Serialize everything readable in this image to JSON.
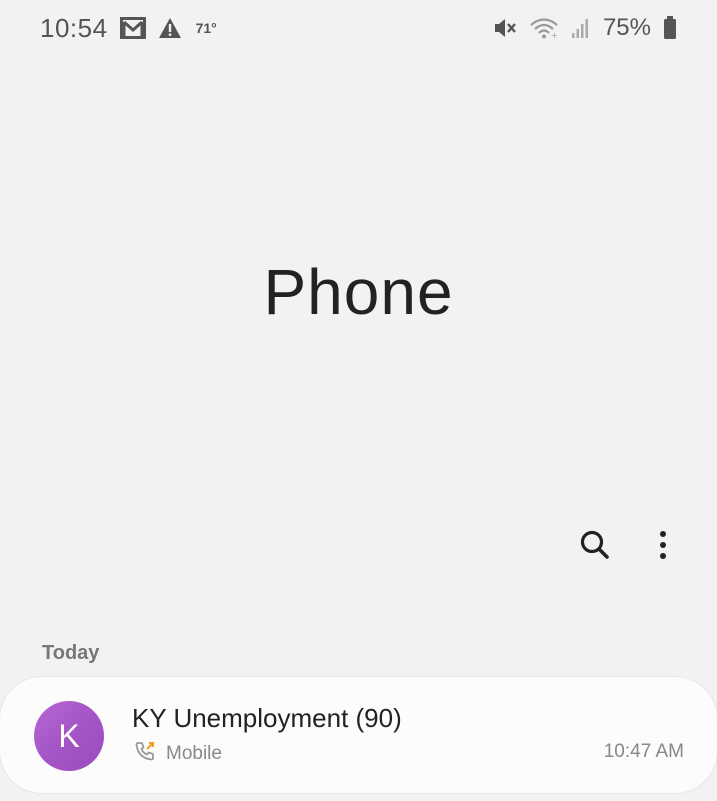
{
  "status_bar": {
    "time": "10:54",
    "temperature": "71°",
    "battery_percent": "75%",
    "icons": [
      "gmail-icon",
      "warning-icon",
      "mute-icon",
      "wifi-icon",
      "signal-icon",
      "battery-icon"
    ]
  },
  "header": {
    "title": "Phone"
  },
  "toolbar": {
    "icons": [
      "search-icon",
      "more-options-icon"
    ]
  },
  "call_log": {
    "section_label": "Today",
    "entries": [
      {
        "avatar_initial": "K",
        "avatar_color": "#a455c6",
        "name": "KY Unemployment (90)",
        "call_type": "Mobile",
        "time": "10:47 AM",
        "call_icon": "outgoing-call-icon",
        "call_icon_accent": "#f0a020"
      }
    ]
  }
}
